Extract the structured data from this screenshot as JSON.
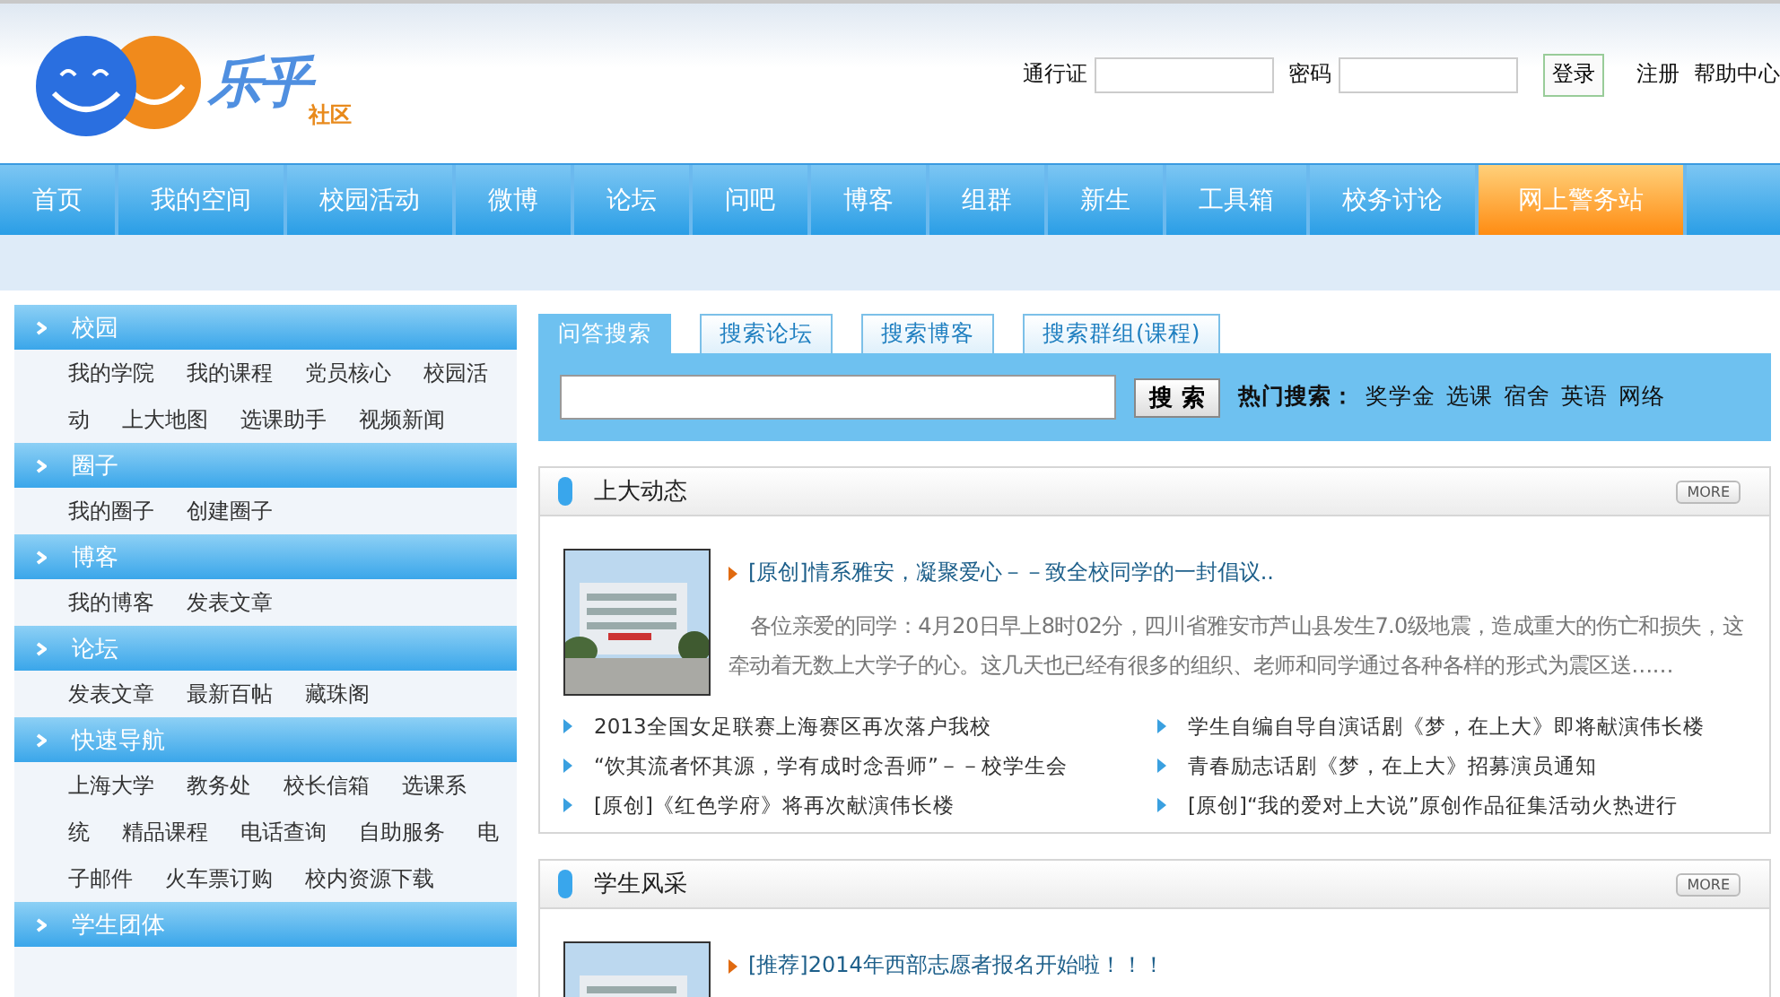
{
  "logo": {
    "title": "乐乎",
    "subtitle": "社区"
  },
  "login": {
    "user_label": "通行证",
    "password_label": "密码",
    "button": "登录",
    "links": [
      "注册",
      "帮助中心"
    ]
  },
  "nav": [
    {
      "label": "首页",
      "selected": false
    },
    {
      "label": "我的空间",
      "selected": false
    },
    {
      "label": "校园活动",
      "selected": false
    },
    {
      "label": "微博",
      "selected": false
    },
    {
      "label": "论坛",
      "selected": false
    },
    {
      "label": "问吧",
      "selected": false
    },
    {
      "label": "博客",
      "selected": false
    },
    {
      "label": "组群",
      "selected": false
    },
    {
      "label": "新生",
      "selected": false
    },
    {
      "label": "工具箱",
      "selected": false
    },
    {
      "label": "校务讨论",
      "selected": false
    },
    {
      "label": "网上警务站",
      "selected": true
    }
  ],
  "sidebar": [
    {
      "title": "校园",
      "links": [
        "我的学院",
        "我的课程",
        "党员核心",
        "校园活动",
        "上大地图",
        "选课助手",
        "视频新闻"
      ]
    },
    {
      "title": "圈子",
      "links": [
        "我的圈子",
        "创建圈子"
      ]
    },
    {
      "title": "博客",
      "links": [
        "我的博客",
        "发表文章"
      ]
    },
    {
      "title": "论坛",
      "links": [
        "发表文章",
        "最新百帖",
        "藏珠阁"
      ]
    },
    {
      "title": "快速导航",
      "links": [
        "上海大学",
        "教务处",
        "校长信箱",
        "选课系统",
        "精品课程",
        "电话查询",
        "自助服务",
        "电子邮件",
        "火车票订购",
        "校内资源下载"
      ]
    },
    {
      "title": "学生团体"
    }
  ],
  "search": {
    "tabs": [
      {
        "label": "问答搜索",
        "selected": true
      },
      {
        "label": "搜索论坛",
        "selected": false
      },
      {
        "label": "搜索博客",
        "selected": false
      },
      {
        "label": "搜索群组(课程)",
        "selected": false
      }
    ],
    "button": "搜 索",
    "hot_label": "热门搜索：",
    "hot": [
      "奖学金",
      "选课",
      "宿舍",
      "英语",
      "网络"
    ]
  },
  "panels": [
    {
      "title": "上大动态",
      "more": "MORE",
      "headline": "[原创]情系雅安，凝聚爱心－－致全校同学的一封倡议..",
      "summary": "各位亲爱的同学：4月20日早上8时02分，四川省雅安市芦山县发生7.0级地震，造成重大的伤亡和损失，这牵动着无数上大学子的心。这几天也已经有很多的组织、老师和同学通过各种各样的形式为震区送……",
      "items": [
        "2013全国女足联赛上海赛区再次落户我校",
        "学生自编自导自演话剧《梦，在上大》即将献演伟长楼",
        "“饮其流者怀其源，学有成时念吾师”－－校学生会",
        "青春励志话剧《梦，在上大》招募演员通知",
        "[原创]《红色学府》将再次献演伟长楼",
        "[原创]“我的爱对上大说”原创作品征集活动火热进行"
      ]
    },
    {
      "title": "学生风采",
      "more": "MORE",
      "headline": "[推荐]2014年西部志愿者报名开始啦！！！"
    }
  ]
}
